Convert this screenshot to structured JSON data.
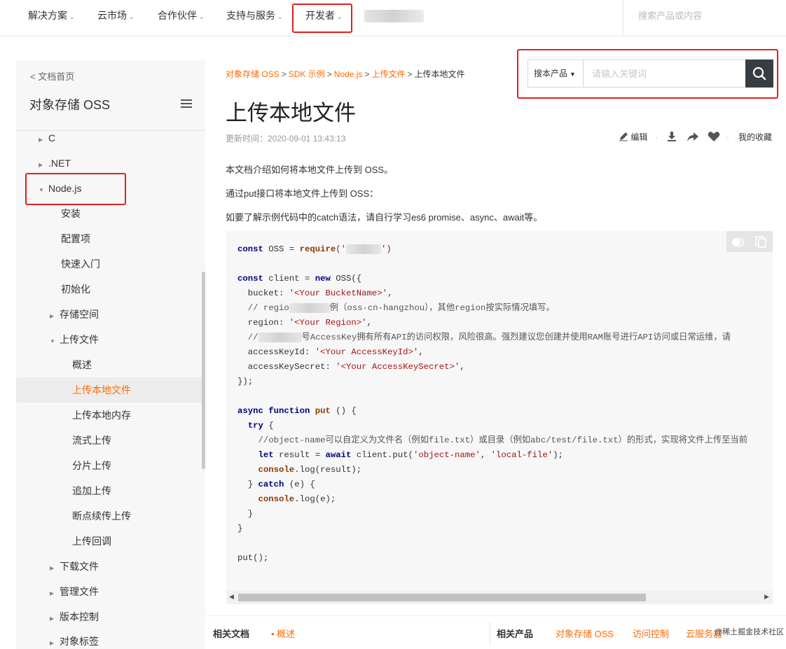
{
  "nav": {
    "items": [
      {
        "label": "解决方案"
      },
      {
        "label": "云市场"
      },
      {
        "label": "合作伙伴"
      },
      {
        "label": "支持与服务"
      },
      {
        "label": "开发者"
      }
    ],
    "search_placeholder": "搜索产品或内容"
  },
  "sidebar": {
    "home_link": "< 文档首页",
    "title": "对象存储 OSS",
    "items": [
      {
        "label": "C"
      },
      {
        "label": ".NET"
      },
      {
        "label": "Node.js"
      },
      {
        "label": "安装"
      },
      {
        "label": "配置项"
      },
      {
        "label": "快速入门"
      },
      {
        "label": "初始化"
      },
      {
        "label": "存储空间"
      },
      {
        "label": "上传文件"
      },
      {
        "label": "概述"
      },
      {
        "label": "上传本地文件"
      },
      {
        "label": "上传本地内存"
      },
      {
        "label": "流式上传"
      },
      {
        "label": "分片上传"
      },
      {
        "label": "追加上传"
      },
      {
        "label": "断点续传上传"
      },
      {
        "label": "上传回调"
      },
      {
        "label": "下载文件"
      },
      {
        "label": "管理文件"
      },
      {
        "label": "版本控制"
      },
      {
        "label": "对象标签"
      }
    ]
  },
  "breadcrumb": {
    "items": [
      "对象存储 OSS",
      "SDK 示例",
      "Node.js",
      "上传文件"
    ],
    "separator": ">",
    "current": "上传本地文件"
  },
  "search": {
    "scope": "搜本产品",
    "placeholder": "请输入关键词"
  },
  "article": {
    "title": "上传本地文件",
    "updated": "更新时间：2020-09-01 13:43:13",
    "actions": {
      "edit": "编辑",
      "favorites": "我的收藏"
    },
    "paragraphs": [
      "本文档介绍如何将本地文件上传到 OSS。",
      "通过put接口将本地文件上传到 OSS：",
      "如要了解示例代码中的catch语法，请自行学习es6 promise、async、await等。"
    ]
  },
  "code": {
    "l1_kw": "const",
    "l1_mid": " OSS = ",
    "l1_fn": "require",
    "l1_s1": "('",
    "l1_s2": "')",
    "l3_kw1": "const",
    "l3_mid": " client = ",
    "l3_kw2": "new",
    "l3_end": " OSS({",
    "l4_key": "  bucket: ",
    "l4_val": "'<Your BucketName>'",
    "l4_end": ",",
    "l5_a": "  // regio",
    "l5_b": "例（oss-cn-hangzhou），其他region按实际情况填写。",
    "l6_key": "  region: ",
    "l6_val": "'<Your Region>'",
    "l6_end": ",",
    "l7_a": "  //",
    "l7_b": "号AccessKey拥有所有API的访问权限，风险很高。强烈建议您创建并使用RAM账号进行API访问或日常运维，请",
    "l8_key": "  accessKeyId: ",
    "l8_val": "'<Your AccessKeyId>'",
    "l8_end": ",",
    "l9_key": "  accessKeySecret: ",
    "l9_val": "'<Your AccessKeySecret>'",
    "l9_end": ",",
    "l10": "});",
    "l12_kw1": "async",
    "l12_kw2": "function",
    "l12_fn": "put",
    "l12_end": " () {",
    "l13_kw": "try",
    "l13_end": " {",
    "l14": "    //object-name可以自定义为文件名（例如file.txt）或目录（例如abc/test/file.txt）的形式，实现将文件上传至当前",
    "l15_kw1": "let",
    "l15_mid": " result = ",
    "l15_kw2": "await",
    "l15_call": " client.put(",
    "l15_s1": "'object-name'",
    "l15_comma": ", ",
    "l15_s2": "'local-file'",
    "l15_end": ");",
    "l16_fn": "console",
    "l16_end": ".log(result);",
    "l17_a": "  } ",
    "l17_kw": "catch",
    "l17_end": " (e) {",
    "l18_fn": "console",
    "l18_end": ".log(e);",
    "l19": "  }",
    "l20": "}",
    "l22": "put();"
  },
  "footer": {
    "related_docs_label": "相关文档",
    "related_doc": "概述",
    "related_products_label": "相关产品",
    "products": [
      "对象存储 OSS",
      "访问控制",
      "云服务器"
    ]
  },
  "watermark": "@稀土掘金技术社区",
  "colors": {
    "accent": "#ff6a00",
    "highlight_border": "#e02020",
    "search_button": "#373d41"
  }
}
